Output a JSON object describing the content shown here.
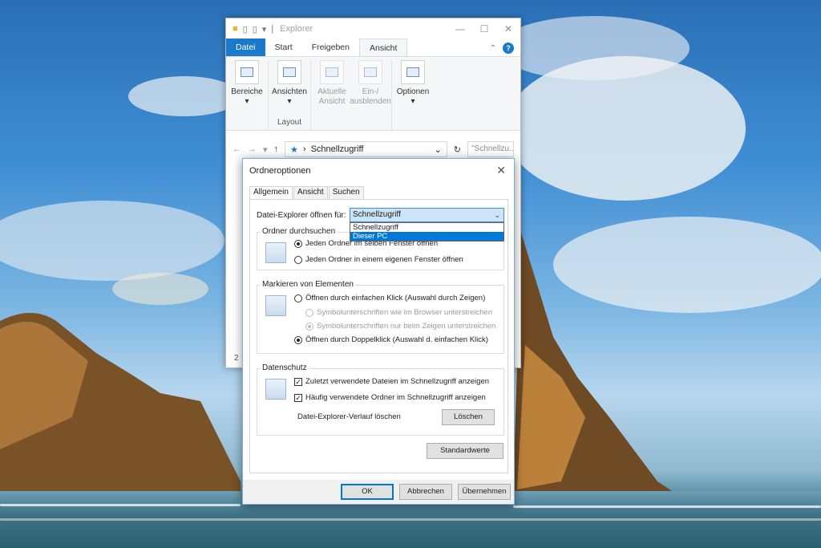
{
  "explorer": {
    "title": "Explorer",
    "tabs": [
      "Datei",
      "Start",
      "Freigeben",
      "Ansicht"
    ],
    "ribbon": {
      "bereiche": "Bereiche",
      "ansichten": "Ansichten",
      "layout_label": "Layout",
      "aktuelle_ansicht_1": "Aktuelle",
      "aktuelle_ansicht_2": "Ansicht",
      "ein_ausblenden_1": "Ein-/",
      "ein_ausblenden_2": "ausblenden",
      "optionen": "Optionen"
    },
    "address": "Schnellzugriff",
    "search_placeholder": "\"Schnellzu...",
    "status": "2"
  },
  "dialog": {
    "title": "Ordneroptionen",
    "tabs": [
      "Allgemein",
      "Ansicht",
      "Suchen"
    ],
    "open_label": "Datei-Explorer öffnen für:",
    "open_value": "Schnellzugriff",
    "open_options": [
      "Schnellzugriff",
      "Dieser PC"
    ],
    "browse_group": "Ordner durchsuchen",
    "browse_same": "Jeden Ordner im selben Fenster öffnen",
    "browse_own": "Jeden Ordner in einem eigenen Fenster öffnen",
    "click_group": "Markieren von Elementen",
    "click_single": "Öffnen durch einfachen Klick (Auswahl durch Zeigen)",
    "underline_browser": "Symbolunterschriften wie im Browser unterstreichen",
    "underline_hover": "Symbolunterschriften nur beim Zeigen unterstreichen",
    "click_double": "Öffnen durch Doppelklick (Auswahl d. einfachen Klick)",
    "privacy_group": "Datenschutz",
    "privacy_recent_files": "Zuletzt verwendete Dateien im Schnellzugriff anzeigen",
    "privacy_frequent_folders": "Häufig verwendete Ordner im Schnellzugriff anzeigen",
    "clear_history_label": "Datei-Explorer-Verlauf löschen",
    "clear_button": "Löschen",
    "defaults_button": "Standardwerte",
    "ok_button": "OK",
    "cancel_button": "Abbrechen",
    "apply_button": "Übernehmen"
  }
}
